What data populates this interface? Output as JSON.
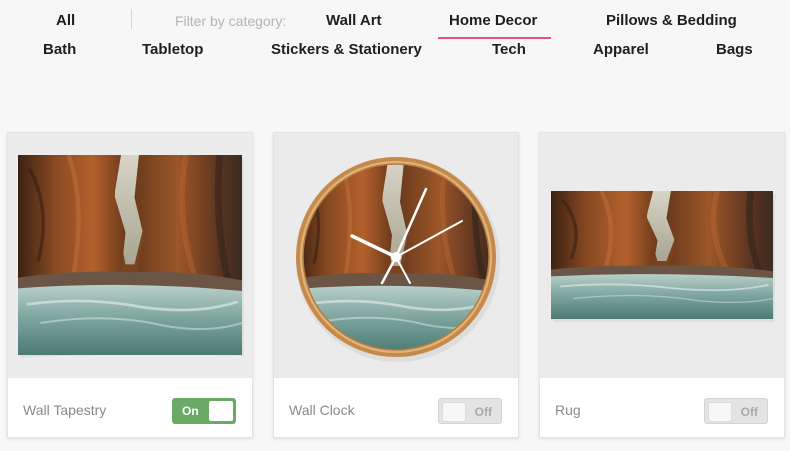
{
  "nav": {
    "all_label": "All",
    "filter_label": "Filter by category:",
    "categories": [
      "Wall Art",
      "Home Decor",
      "Pillows & Bedding",
      "Bath",
      "Tabletop",
      "Stickers & Stationery",
      "Tech",
      "Apparel",
      "Bags"
    ],
    "active_category": "Home Decor",
    "accent_color": "#e8527a"
  },
  "products": [
    {
      "label": "Wall Tapestry",
      "image": "canyon-river-wall-tapestry",
      "toggle": {
        "state": "on",
        "text": "On"
      }
    },
    {
      "label": "Wall Clock",
      "image": "canyon-river-wall-clock",
      "toggle": {
        "state": "off",
        "text": "Off"
      }
    },
    {
      "label": "Rug",
      "image": "canyon-river-rug",
      "toggle": {
        "state": "off",
        "text": "Off"
      }
    }
  ],
  "colors": {
    "toggle_on": "#6aaa66",
    "toggle_off": "#e4e4e4"
  }
}
